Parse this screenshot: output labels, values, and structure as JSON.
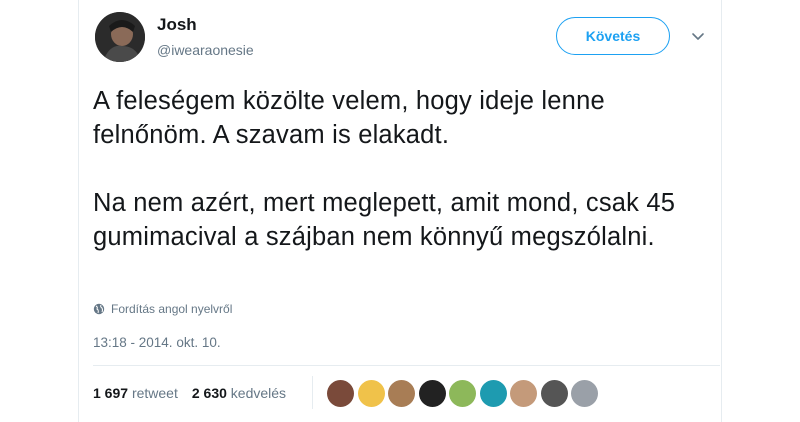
{
  "user": {
    "name": "Josh",
    "handle": "@iwearaonesie"
  },
  "follow_label": "Követés",
  "tweet": {
    "line1": "A feleségem közölte velem, hogy ideje lenne felnőnöm. A szavam is elakadt.",
    "line2": "Na nem azért, mert meglepett, amit mond, csak 45 gumimacival a szájban nem könnyű megszólalni."
  },
  "translate_label": "Fordítás angol nyelvről",
  "timestamp": "13:18 - 2014. okt. 10.",
  "stats": {
    "retweets_count": "1 697",
    "retweets_label": "retweet",
    "likes_count": "2 630",
    "likes_label": "kedvelés"
  },
  "likers": [
    {
      "color": "#7a4a3a"
    },
    {
      "color": "#f0c24a"
    },
    {
      "color": "#a87d55"
    },
    {
      "color": "#222222"
    },
    {
      "color": "#8db85a"
    },
    {
      "color": "#1e9bb0"
    },
    {
      "color": "#c49a7a"
    },
    {
      "color": "#555555"
    },
    {
      "color": "#9aa0a8"
    }
  ]
}
